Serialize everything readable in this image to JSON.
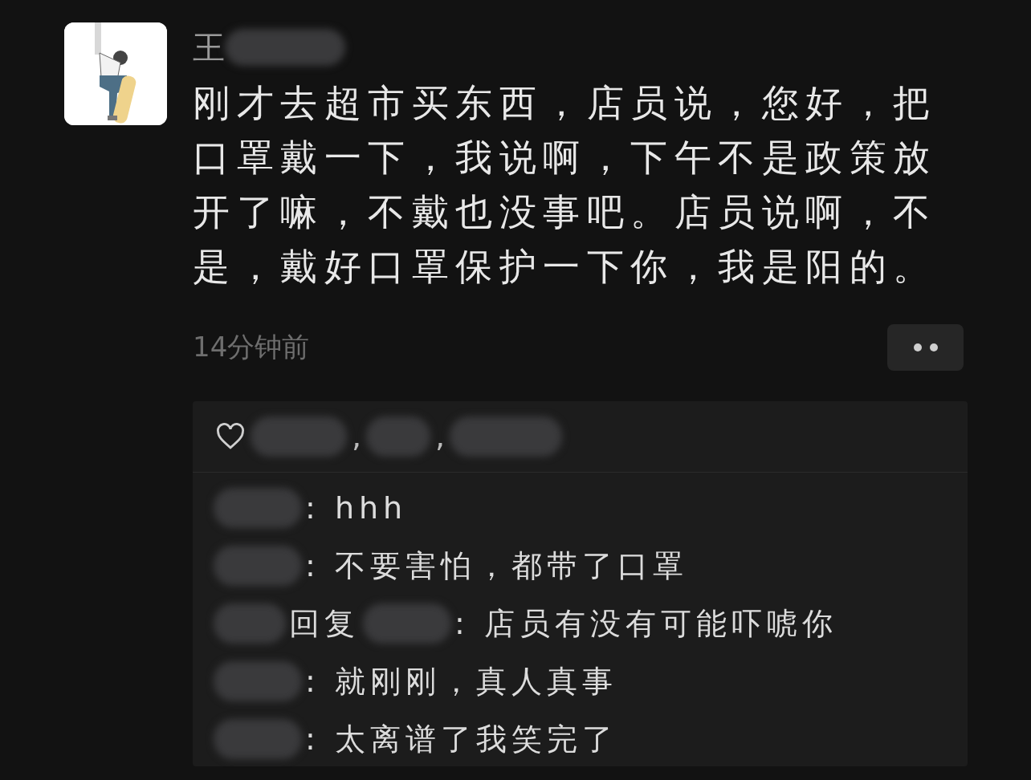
{
  "post": {
    "author_visible": "王",
    "text": "刚才去超市买东西，店员说，您好，把口罩戴一下，我说啊，下午不是政策放开了嘛，不戴也没事吧。店员说啊，不是，戴好口罩保护一下你，我是阳的。",
    "time": "14分钟前"
  },
  "likes": {
    "separator": ",",
    "names": [
      {
        "kind": "hidden"
      },
      {
        "kind": "hidden"
      },
      {
        "kind": "hidden"
      }
    ]
  },
  "comments": [
    {
      "kind": "plain",
      "text": ": hhh"
    },
    {
      "kind": "plain",
      "text": ": 不要害怕，都带了口罩"
    },
    {
      "kind": "reply",
      "reply_label": "回复",
      "text": ": 店员有没有可能吓唬你"
    },
    {
      "kind": "plain",
      "text": ": 就刚刚，真人真事"
    },
    {
      "kind": "plain",
      "text": ": 太离谱了我笑完了"
    }
  ]
}
